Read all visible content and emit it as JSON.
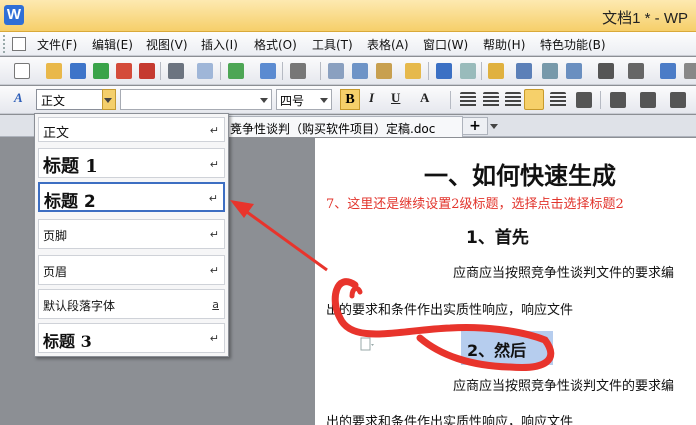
{
  "window": {
    "title": "文档1 * - WP",
    "logo": "W"
  },
  "menu": {
    "items": [
      "文件(F)",
      "编辑(E)",
      "视图(V)",
      "插入(I)",
      "格式(O)",
      "工具(T)",
      "表格(A)",
      "窗口(W)",
      "帮助(H)",
      "特色功能(B)"
    ]
  },
  "formatting": {
    "style_value": "正文",
    "font_value": "",
    "size_value": "四号",
    "bold": "B"
  },
  "tabs": {
    "doc_tab_label": "竞争性谈判（购买软件项目）定稿.doc",
    "close": "×",
    "add": "+"
  },
  "dropdown": {
    "items": [
      {
        "label": "正文",
        "mark": "↵"
      },
      {
        "label": "标题 1",
        "mark": "↵"
      },
      {
        "label": "标题 2",
        "mark": "↵"
      },
      {
        "label": "页脚",
        "mark": "↵"
      },
      {
        "label": "页眉",
        "mark": "↵"
      },
      {
        "label": "默认段落字体",
        "mark": "a"
      },
      {
        "label": "标题 3",
        "mark": "↵"
      }
    ]
  },
  "document": {
    "heading1": "一、如何快速生成",
    "annotation": "7、这里还是继续设置2级标题，选择点击选择标题2",
    "heading2_first": "1、首先",
    "para1": "应商应当按照竞争性谈判文件的要求编",
    "para2": "出的要求和条件作出实质性响应，响应文件",
    "heading2_second": "2、然后",
    "para3": "应商应当按照竞争性谈判文件的要求编",
    "para4": "出的要求和条件作出实质性响应，响应文件"
  },
  "colors": {
    "accent": "#f6cf6a",
    "annotation": "#e2342c",
    "selection": "#b6cdee",
    "selected_border": "#3d6ec2"
  }
}
